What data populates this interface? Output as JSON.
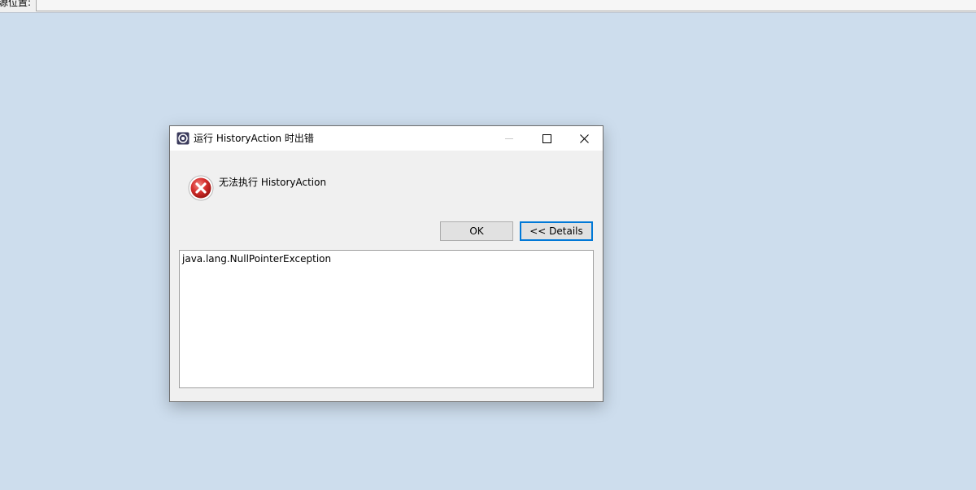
{
  "background_app": {
    "field_label": "源位置:"
  },
  "dialog": {
    "title": "运行 HistoryAction 时出错",
    "window_controls": {
      "minimize_icon": "minimize-icon",
      "maximize_icon": "maximize-icon",
      "close_icon": "close-icon"
    },
    "message": "无法执行 HistoryAction",
    "buttons": {
      "ok_label": "OK",
      "details_label": "<< Details"
    },
    "details_text": "java.lang.NullPointerException"
  },
  "colors": {
    "desktop_bg": "#cddded",
    "dialog_bg": "#f0f0f0",
    "focus_border": "#0078d7",
    "error_red": "#d6302e"
  }
}
